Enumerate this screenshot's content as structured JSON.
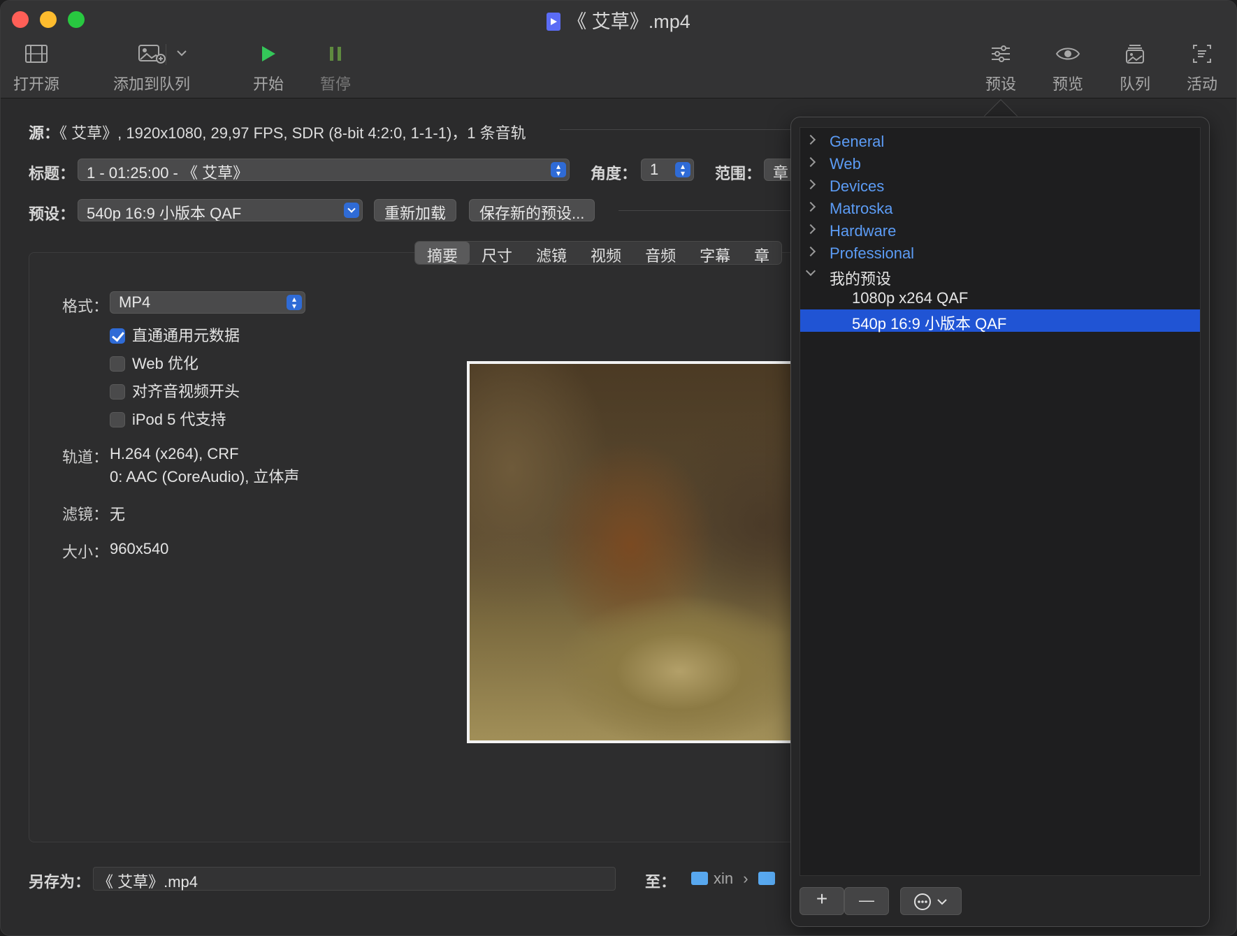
{
  "window": {
    "title": "《 艾草》.mp4"
  },
  "toolbar": {
    "open_source": "打开源",
    "add_to_queue": "添加到队列",
    "start": "开始",
    "pause": "暂停",
    "presets": "预设",
    "preview": "预览",
    "queue": "队列",
    "activity": "活动"
  },
  "source": {
    "label": "源：",
    "value": "《 艾草》, 1920x1080, 29,97 FPS, SDR (8-bit 4:2:0, 1-1-1)，1 条音轨"
  },
  "title_row": {
    "label": "标题：",
    "value": "1 - 01:25:00 - 《 艾草》",
    "angle_label": "角度：",
    "angle_value": "1",
    "range_label": "范围：",
    "range_value": "章"
  },
  "preset_row": {
    "label": "预设：",
    "value": "540p 16:9 小版本 QAF",
    "reload": "重新加载",
    "save_new": "保存新的预设..."
  },
  "tabs": [
    "摘要",
    "尺寸",
    "滤镜",
    "视频",
    "音频",
    "字幕",
    "章"
  ],
  "summary": {
    "format_label": "格式：",
    "format_value": "MP4",
    "options": [
      {
        "label": "直通通用元数据",
        "checked": true
      },
      {
        "label": "Web 优化",
        "checked": false
      },
      {
        "label": "对齐音视频开头",
        "checked": false
      },
      {
        "label": "iPod 5 代支持",
        "checked": false
      }
    ],
    "tracks_label": "轨道：",
    "tracks": [
      "H.264 (x264), CRF",
      "0: AAC (CoreAudio), 立体声"
    ],
    "filters_label": "滤镜：",
    "filters_value": "无",
    "size_label": "大小：",
    "size_value": "960x540"
  },
  "bottom": {
    "save_as_label": "另存为：",
    "save_as_value": "《 艾草》.mp4",
    "to_label": "至：",
    "path": [
      "xin",
      "›"
    ]
  },
  "presets_popover": {
    "groups": [
      "General",
      "Web",
      "Devices",
      "Matroska",
      "Hardware",
      "Professional"
    ],
    "my_presets_label": "我的预设",
    "my_presets": [
      "1080p x264 QAF",
      "540p 16:9 小版本 QAF"
    ],
    "selected": "540p 16:9 小版本 QAF",
    "add_symbol": "+",
    "remove_symbol": "—"
  },
  "colors": {
    "accent": "#2f6bd6",
    "selection": "#2054d4",
    "group_link": "#5c9cf5",
    "play_green": "#34c759"
  }
}
